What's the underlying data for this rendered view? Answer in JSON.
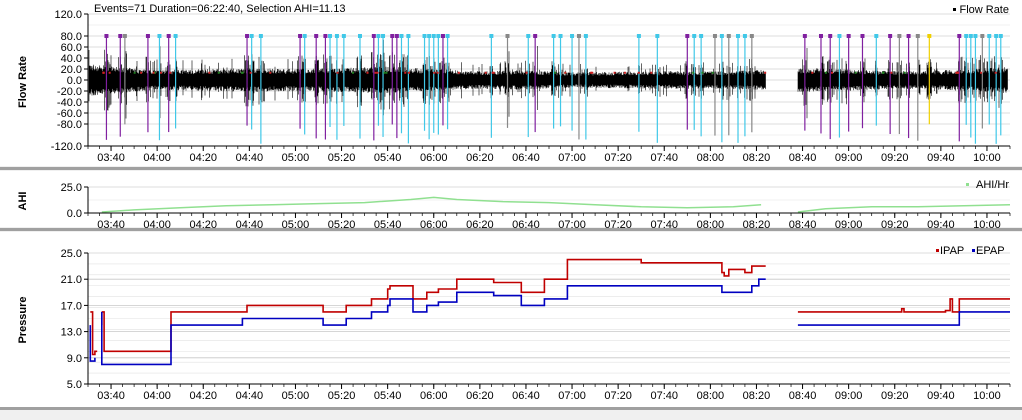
{
  "header": {
    "summary": "Events=71 Duration=06:22:40, Selection AHI=11.13"
  },
  "colors": {
    "flow": "#000000",
    "ahi": "#90e090",
    "ipap": "#c00000",
    "epap": "#0000c0",
    "event_cyan": "#40c8e8",
    "event_purple": "#8020a0",
    "event_gray": "#888888",
    "event_yellow": "#f0d000",
    "event_green": "#208020",
    "event_red": "#d02020",
    "grid": "#c8c8c8",
    "panel_bg": "#ffffff"
  },
  "time_axis": {
    "start": "03:30",
    "end": "10:10",
    "ticks": [
      "03:40",
      "04:00",
      "04:20",
      "04:40",
      "05:00",
      "05:20",
      "05:40",
      "06:00",
      "06:20",
      "06:40",
      "07:00",
      "07:20",
      "07:40",
      "08:00",
      "08:20",
      "08:40",
      "09:00",
      "09:20",
      "09:40",
      "10:00"
    ]
  },
  "chart_data": [
    {
      "type": "line",
      "ylabel": "Flow Rate",
      "legend": [
        "Flow Rate"
      ],
      "legend_placement": "top-right",
      "ylim": [
        -120,
        120
      ],
      "y_ticks": [
        "120.0",
        "80.0",
        "60.0",
        "40.0",
        "20.0",
        "0.0",
        "-20.0",
        "-40.0",
        "-60.0",
        "-80.0",
        "-120.0"
      ],
      "grid": true,
      "gap": [
        "08:24",
        "08:38"
      ],
      "amplitude_envelope": [
        [
          "03:30",
          30
        ],
        [
          "03:40",
          25
        ],
        [
          "04:00",
          18
        ],
        [
          "04:20",
          20
        ],
        [
          "04:40",
          22
        ],
        [
          "05:00",
          20
        ],
        [
          "05:20",
          22
        ],
        [
          "05:40",
          25
        ],
        [
          "06:00",
          20
        ],
        [
          "06:20",
          16
        ],
        [
          "06:40",
          18
        ],
        [
          "07:00",
          14
        ],
        [
          "07:20",
          15
        ],
        [
          "07:40",
          16
        ],
        [
          "08:00",
          16
        ],
        [
          "08:20",
          18
        ],
        [
          "08:40",
          22
        ],
        [
          "09:00",
          20
        ],
        [
          "09:20",
          16
        ],
        [
          "09:40",
          18
        ],
        [
          "10:00",
          22
        ],
        [
          "10:10",
          24
        ]
      ],
      "events": [
        {
          "t": "03:38",
          "c": "purple"
        },
        {
          "t": "03:44",
          "c": "purple"
        },
        {
          "t": "03:46",
          "c": "gray"
        },
        {
          "t": "03:56",
          "c": "purple"
        },
        {
          "t": "04:01",
          "c": "cyan"
        },
        {
          "t": "04:05",
          "c": "purple"
        },
        {
          "t": "04:08",
          "c": "cyan"
        },
        {
          "t": "04:39",
          "c": "purple"
        },
        {
          "t": "04:41",
          "c": "cyan"
        },
        {
          "t": "04:45",
          "c": "cyan"
        },
        {
          "t": "05:02",
          "c": "purple"
        },
        {
          "t": "05:04",
          "c": "cyan"
        },
        {
          "t": "05:09",
          "c": "purple"
        },
        {
          "t": "05:13",
          "c": "purple"
        },
        {
          "t": "05:15",
          "c": "cyan"
        },
        {
          "t": "05:18",
          "c": "cyan"
        },
        {
          "t": "05:21",
          "c": "cyan"
        },
        {
          "t": "05:28",
          "c": "cyan"
        },
        {
          "t": "05:34",
          "c": "purple"
        },
        {
          "t": "05:36",
          "c": "cyan"
        },
        {
          "t": "05:38",
          "c": "cyan"
        },
        {
          "t": "05:42",
          "c": "purple"
        },
        {
          "t": "05:44",
          "c": "purple"
        },
        {
          "t": "05:46",
          "c": "cyan"
        },
        {
          "t": "05:49",
          "c": "cyan"
        },
        {
          "t": "05:56",
          "c": "cyan"
        },
        {
          "t": "05:58",
          "c": "cyan"
        },
        {
          "t": "06:00",
          "c": "cyan"
        },
        {
          "t": "06:02",
          "c": "cyan"
        },
        {
          "t": "06:04",
          "c": "purple"
        },
        {
          "t": "06:06",
          "c": "cyan"
        },
        {
          "t": "06:25",
          "c": "cyan"
        },
        {
          "t": "06:32",
          "c": "gray"
        },
        {
          "t": "06:41",
          "c": "cyan"
        },
        {
          "t": "06:44",
          "c": "purple"
        },
        {
          "t": "06:52",
          "c": "cyan"
        },
        {
          "t": "06:55",
          "c": "cyan"
        },
        {
          "t": "07:00",
          "c": "cyan"
        },
        {
          "t": "07:03",
          "c": "gray"
        },
        {
          "t": "07:06",
          "c": "cyan"
        },
        {
          "t": "07:29",
          "c": "cyan"
        },
        {
          "t": "07:37",
          "c": "cyan"
        },
        {
          "t": "07:50",
          "c": "purple"
        },
        {
          "t": "07:53",
          "c": "cyan"
        },
        {
          "t": "07:56",
          "c": "cyan"
        },
        {
          "t": "08:02",
          "c": "gray"
        },
        {
          "t": "08:05",
          "c": "cyan"
        },
        {
          "t": "08:08",
          "c": "gray"
        },
        {
          "t": "08:12",
          "c": "cyan"
        },
        {
          "t": "08:15",
          "c": "cyan"
        },
        {
          "t": "08:18",
          "c": "gray"
        },
        {
          "t": "08:41",
          "c": "purple"
        },
        {
          "t": "08:48",
          "c": "purple"
        },
        {
          "t": "08:52",
          "c": "purple"
        },
        {
          "t": "08:56",
          "c": "cyan"
        },
        {
          "t": "09:00",
          "c": "purple"
        },
        {
          "t": "09:06",
          "c": "purple"
        },
        {
          "t": "09:12",
          "c": "cyan"
        },
        {
          "t": "09:18",
          "c": "purple"
        },
        {
          "t": "09:22",
          "c": "gray"
        },
        {
          "t": "09:26",
          "c": "purple"
        },
        {
          "t": "09:30",
          "c": "gray"
        },
        {
          "t": "09:35",
          "c": "yellow"
        },
        {
          "t": "09:48",
          "c": "purple"
        },
        {
          "t": "09:51",
          "c": "cyan"
        },
        {
          "t": "09:53",
          "c": "cyan"
        },
        {
          "t": "09:55",
          "c": "cyan"
        },
        {
          "t": "09:58",
          "c": "gray"
        },
        {
          "t": "10:01",
          "c": "cyan"
        },
        {
          "t": "10:04",
          "c": "cyan"
        },
        {
          "t": "10:06",
          "c": "cyan"
        }
      ]
    },
    {
      "type": "line",
      "ylabel": "AHI",
      "legend": [
        "AHI/Hr"
      ],
      "legend_placement": "top-right",
      "ylim": [
        0,
        25
      ],
      "y_ticks": [
        "25.0",
        "0.0"
      ],
      "grid": true,
      "series": [
        {
          "name": "AHI/Hr",
          "x": [
            "03:36",
            "03:50",
            "04:10",
            "04:30",
            "04:50",
            "05:10",
            "05:30",
            "05:50",
            "06:00",
            "06:10",
            "06:30",
            "06:50",
            "07:10",
            "07:30",
            "07:50",
            "08:10",
            "08:22"
          ],
          "y": [
            1,
            3,
            5,
            7,
            8,
            9,
            10,
            13,
            15,
            13,
            11,
            10,
            8,
            6,
            5,
            6,
            8
          ]
        },
        {
          "name": "AHI/Hr",
          "x": [
            "08:38",
            "08:50",
            "09:10",
            "09:30",
            "09:50",
            "10:10"
          ],
          "y": [
            1,
            4,
            6,
            6,
            7,
            8
          ]
        }
      ]
    },
    {
      "type": "line",
      "ylabel": "Pressure",
      "legend": [
        "IPAP",
        "EPAP"
      ],
      "legend_placement": "top-right",
      "ylim": [
        5,
        25
      ],
      "y_ticks": [
        "25.0",
        "21.0",
        "17.0",
        "13.0",
        "9.0",
        "5.0"
      ],
      "grid": true,
      "series": [
        {
          "name": "IPAP",
          "segments": [
            {
              "x": [
                "03:31",
                "03:31",
                "03:32",
                "03:33",
                "03:33",
                "03:34"
              ],
              "y": [
                16,
                16,
                9.5,
                9.5,
                10,
                10
              ]
            },
            {
              "x": [
                "03:36",
                "03:36"
              ],
              "y": [
                16,
                14
              ]
            },
            {
              "x": [
                "03:36",
                "03:37",
                "04:06",
                "04:36",
                "04:39",
                "05:10",
                "05:12",
                "05:19",
                "05:22",
                "05:30",
                "05:33",
                "05:37",
                "05:40",
                "05:41",
                "05:51",
                "05:54",
                "05:57",
                "06:00",
                "06:02",
                "06:09",
                "06:10",
                "06:25",
                "06:26",
                "06:37",
                "06:38",
                "06:46",
                "06:48",
                "06:57",
                "06:58",
                "07:28",
                "07:30",
                "08:02",
                "08:05",
                "08:06",
                "08:08",
                "08:14",
                "08:15",
                "08:17",
                "08:18",
                "08:21",
                "08:24"
              ],
              "y": [
                16,
                10,
                16,
                16,
                17,
                17,
                16,
                16,
                17,
                17,
                18,
                18,
                19.5,
                20,
                18,
                18,
                19,
                19,
                19.5,
                19.5,
                21,
                21,
                20.5,
                20.5,
                19,
                19,
                21,
                21,
                24,
                24,
                23.5,
                23.5,
                22,
                21.5,
                22.5,
                22.5,
                22,
                22,
                23,
                23,
                23
              ]
            }
          ]
        },
        {
          "name": "EPAP",
          "segments": [
            {
              "x": [
                "03:31",
                "03:31",
                "03:32",
                "03:33"
              ],
              "y": [
                14,
                8.5,
                8.5,
                9
              ]
            },
            {
              "x": [
                "03:36",
                "03:36",
                "03:37",
                "04:06",
                "04:36",
                "04:37",
                "05:10",
                "05:12",
                "05:19",
                "05:22",
                "05:30",
                "05:33",
                "05:37",
                "05:40",
                "05:41",
                "05:51",
                "05:54",
                "05:57",
                "06:00",
                "06:02",
                "06:09",
                "06:10",
                "06:25",
                "06:26",
                "06:37",
                "06:38",
                "06:46",
                "06:48",
                "06:57",
                "06:58",
                "07:28",
                "07:30",
                "08:02",
                "08:05",
                "08:06",
                "08:14",
                "08:17",
                "08:18",
                "08:21",
                "08:24"
              ],
              "y": [
                16,
                8,
                8,
                14,
                14,
                15,
                15,
                14,
                14,
                15,
                15,
                16,
                16,
                17,
                18,
                16,
                16,
                17,
                17,
                17.5,
                17.5,
                19,
                19,
                18.5,
                18.5,
                17,
                17,
                18,
                18,
                20,
                20,
                20,
                20,
                19,
                19,
                19,
                19,
                20,
                21,
                21
              ]
            }
          ]
        },
        {
          "name": "IPAP",
          "segments": [
            {
              "x": [
                "08:38",
                "09:22",
                "09:23",
                "09:24",
                "09:41",
                "09:42",
                "09:44",
                "09:45",
                "09:47",
                "09:48",
                "10:10"
              ],
              "y": [
                16,
                16,
                16.5,
                16,
                16,
                16.2,
                18,
                16,
                16,
                18,
                18
              ]
            }
          ]
        },
        {
          "name": "EPAP",
          "segments": [
            {
              "x": [
                "08:38",
                "09:46",
                "09:48",
                "10:10"
              ],
              "y": [
                14,
                14,
                16,
                16
              ]
            }
          ]
        }
      ]
    }
  ]
}
